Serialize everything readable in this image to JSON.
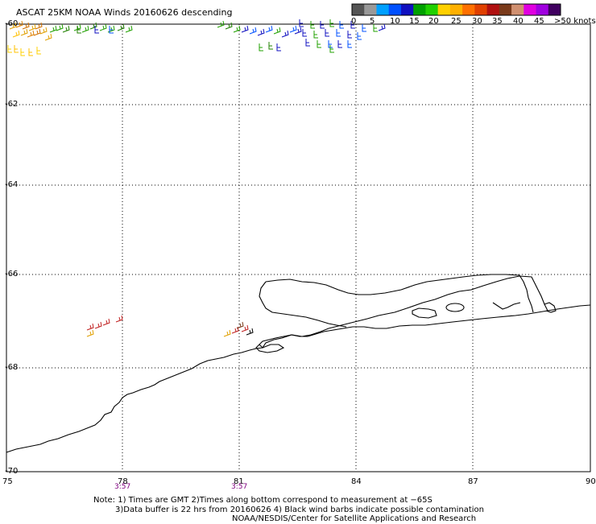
{
  "title": "ASCAT 25KM NOAA Winds 20160626 descending",
  "color_scale": {
    "colors": [
      "#555555",
      "#999999",
      "#00a0ff",
      "#0050ff",
      "#1010c0",
      "#00a000",
      "#20d000",
      "#ffd000",
      "#ffb000",
      "#ff7000",
      "#e04000",
      "#b01010",
      "#7a3a1a",
      "#d09070",
      "#e000e0",
      "#a000e0",
      "#400060"
    ],
    "labels": [
      "0",
      "5",
      "10",
      "15",
      "20",
      "25",
      "30",
      "35",
      "40",
      "45",
      ">50 knots"
    ]
  },
  "lat_labels": [
    "-60",
    "-62",
    "-64",
    "-66",
    "-68",
    "-70"
  ],
  "lon_labels": [
    "75",
    "78",
    "81",
    "84",
    "87",
    "90"
  ],
  "time_labels": [
    "3:57",
    "3:57"
  ],
  "notes": [
    "Note: 1) Times are GMT 2)Times along bottom correspond to measurement at −65S",
    "3)Data buffer is 22 hrs from 20160626 4) Black wind barbs indicate possible contamination",
    "NOAA/NESDIS/Center for Satellite Applications and Research"
  ]
}
